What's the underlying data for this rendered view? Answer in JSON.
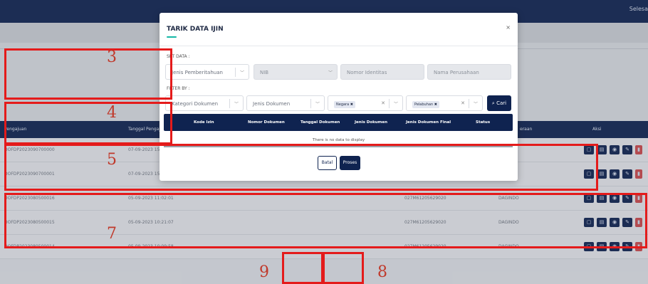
{
  "topbar": {
    "user_text": "Selesa"
  },
  "table": {
    "headers": [
      "Pengajuan",
      "Tanggal Pengaju",
      "eraan",
      "Aksi"
    ],
    "rows": [
      {
        "id": "DOFDP2023090700000",
        "date": "07-09-2023 15:0",
        "col5": "",
        "col6": ""
      },
      {
        "id": "DOFDP2023090700001",
        "date": "07-09-2023 15:01",
        "col5": "",
        "col6": ""
      },
      {
        "id": "DOFDP2023080500016",
        "date": "05-09-2023 11:02:01",
        "col5": "027M61205629020",
        "col6": "DAGINDO"
      },
      {
        "id": "DOFDP2023080500015",
        "date": "05-09-2023 10:21:07",
        "col5": "027M61205629020",
        "col6": "DAGINDO"
      },
      {
        "id": "DOFDP2023080500014",
        "date": "05-09-2023 10:09:58",
        "col5": "027M61205629020",
        "col6": "DAGINDO"
      }
    ]
  },
  "modal": {
    "title": "TARIK DATA IJIN",
    "close": "×",
    "set_data_label": "SET DATA :",
    "filter_label": "FILTER BY :",
    "jenis_pemberitahuan": "Jenis Pemberitahuan",
    "nib": "NIB",
    "nomor_identitas": "Nomor Identitas",
    "nama_perusahaan": "Nama Perusahaan",
    "kategori_dokumen": "Kategori Dokumen",
    "jenis_dokumen": "Jenis Dokumen",
    "negara_chip": "Negara ✖",
    "pelabuhan_chip": "Pelabuhan ✖",
    "cari": "Cari",
    "columns": [
      "Kode Izin",
      "Nomor Dokumen",
      "Tanggal Dokumen",
      "Jenis Dokumen",
      "Jenis Dokumen Final",
      "Status"
    ],
    "no_data": "There is no data to display",
    "batal": "Batal",
    "proses": "Proses"
  },
  "annotations": [
    "3",
    "4",
    "5",
    "7",
    "9",
    "8"
  ],
  "colors": {
    "navy": "#0f2350",
    "accent": "#14b8a6",
    "annotation": "#e41b1b"
  }
}
